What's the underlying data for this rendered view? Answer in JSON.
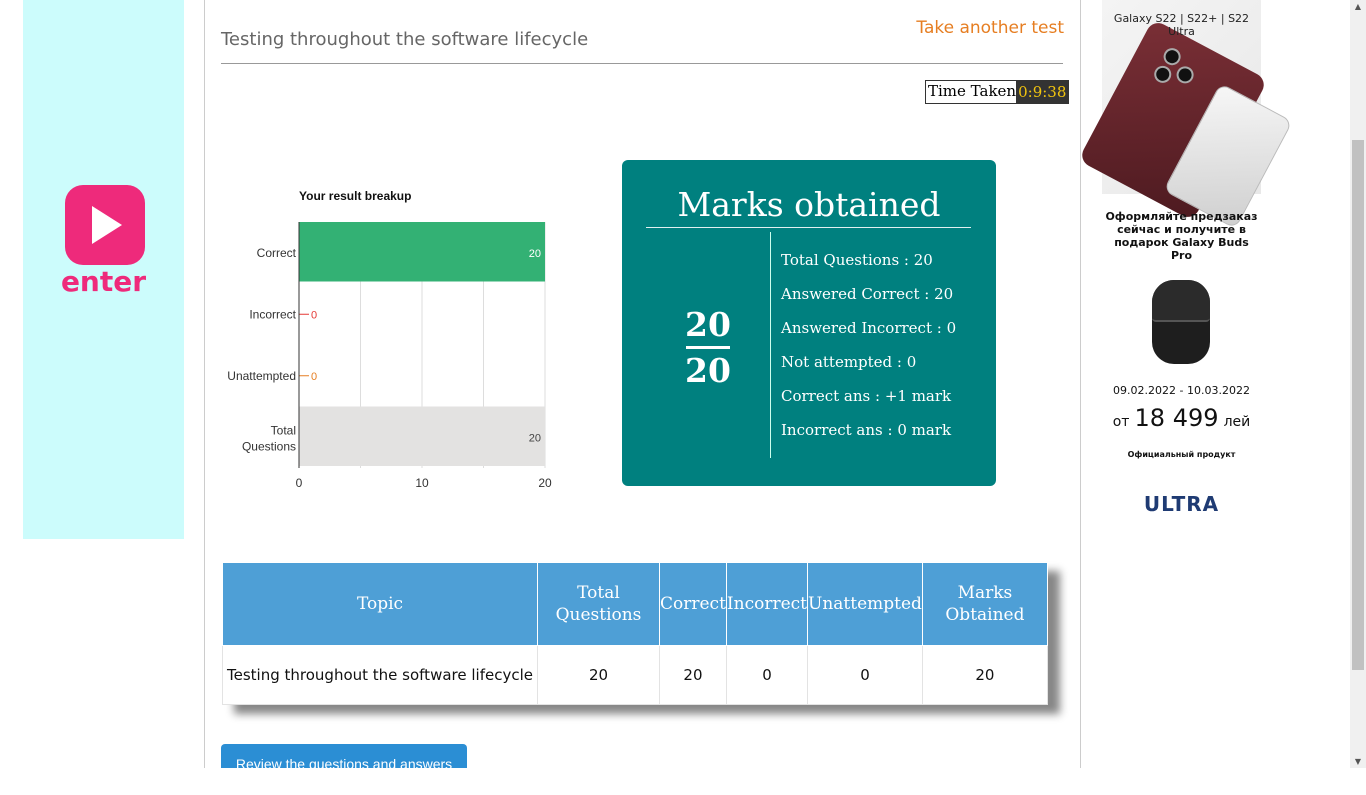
{
  "page": {
    "title": "Testing throughout the software lifecycle",
    "take_another": "Take another test",
    "time_label": "Time Taken",
    "time_value": "0:9:38",
    "review_button": "Review the questions and answers"
  },
  "left_ad": {
    "brand": "enter"
  },
  "chart_data": {
    "type": "bar",
    "title": "Your result breakup",
    "categories": [
      "Correct",
      "Incorrect",
      "Unattempted",
      "Total Questions"
    ],
    "values": [
      20,
      0,
      0,
      20
    ],
    "bar_colors": [
      "#33b174",
      "#e53935",
      "#e67e22",
      "#e3e2e1"
    ],
    "xlim": [
      0,
      20
    ],
    "xticks": [
      "0",
      "10",
      "20"
    ],
    "orientation": "horizontal",
    "grid": true
  },
  "marks": {
    "title": "Marks obtained",
    "score_numerator": "20",
    "score_denominator": "20",
    "stats": [
      "Total Questions : 20",
      "Answered Correct : 20",
      "Answered Incorrect : 0",
      "Not attempted : 0",
      "Correct ans : +1 mark",
      "Incorrect ans : 0 mark"
    ]
  },
  "table": {
    "headers": [
      "Topic",
      "Total Questions",
      "Correct",
      "Incorrect",
      "Unattempted",
      "Marks Obtained"
    ],
    "rows": [
      [
        "Testing throughout the software lifecycle",
        "20",
        "20",
        "0",
        "0",
        "20"
      ]
    ]
  },
  "right_ad": {
    "headline": "Galaxy S22 | S22+ | S22 Ultra",
    "promo": "Оформляйте предзаказ сейчас и получите в подарок Galaxy Buds Pro",
    "dates": "09.02.2022 - 10.03.2022",
    "price_prefix": "от",
    "price": "18 499",
    "currency": "лей",
    "official": "Официальный продукт",
    "brand": "ULTRA"
  },
  "colors": {
    "accent_orange": "#e67e22",
    "panel_teal": "#00807f",
    "table_header": "#4e9fd6",
    "button_blue": "#2b8ed4"
  }
}
